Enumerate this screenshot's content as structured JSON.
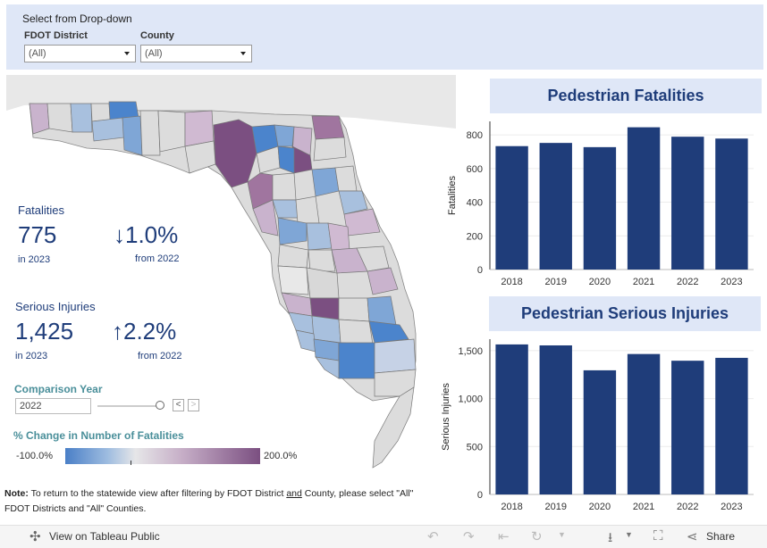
{
  "filters": {
    "title": "Select from Drop-down",
    "district_label": "FDOT District",
    "district_value": "(All)",
    "county_label": "County",
    "county_value": "(All)"
  },
  "kpis": {
    "fatalities": {
      "label": "Fatalities",
      "value": "775",
      "year_text": "in 2023",
      "change_arrow": "↓",
      "change_value": "1.0%",
      "change_text": "from 2022"
    },
    "injuries": {
      "label": "Serious Injuries",
      "value": "1,425",
      "year_text": "in 2023",
      "change_arrow": "↑",
      "change_value": "2.2%",
      "change_text": "from 2022"
    }
  },
  "comparison": {
    "label": "Comparison Year",
    "value": "2022",
    "prev_symbol": "<",
    "next_symbol": ">"
  },
  "legend": {
    "title": "% Change in Number of Fatalities",
    "min_label": "-100.0%",
    "max_label": "200.0%",
    "colors": [
      "#4a7fc7",
      "#e6e6e8",
      "#7b4f81"
    ]
  },
  "note": {
    "bold": "Note:",
    "text1": " To return to the statewide view after filtering by FDOT District ",
    "underlined": "and",
    "text2": " County, please select \"All\" FDOT Districts  and \"All\" Counties."
  },
  "chart_data": [
    {
      "type": "bar",
      "title": "Pedestrian Fatalities",
      "ylabel": "Fatalities",
      "categories": [
        "2018",
        "2019",
        "2020",
        "2021",
        "2022",
        "2023"
      ],
      "values": [
        733,
        752,
        727,
        845,
        789,
        778
      ],
      "ylim": [
        0,
        880
      ],
      "yticks": [
        0,
        200,
        400,
        600,
        800
      ],
      "ytick_labels": [
        "0",
        "200",
        "400",
        "600",
        "800"
      ],
      "bar_color": "#1f3d7a",
      "grid": true
    },
    {
      "type": "bar",
      "title": "Pedestrian Serious Injuries",
      "ylabel": "Serious Injuries",
      "categories": [
        "2018",
        "2019",
        "2020",
        "2021",
        "2022",
        "2023"
      ],
      "values": [
        1565,
        1555,
        1295,
        1465,
        1395,
        1425
      ],
      "ylim": [
        0,
        1620
      ],
      "yticks": [
        0,
        500,
        1000,
        1500
      ],
      "ytick_labels": [
        "0",
        "500",
        "1,000",
        "1,500"
      ],
      "bar_color": "#1f3d7a",
      "grid": true
    }
  ],
  "toolbar": {
    "view_label": "View on Tableau Public",
    "share_label": "Share",
    "icons": [
      "tableau-logo-icon",
      "undo-icon",
      "redo-icon",
      "revert-icon",
      "refresh-icon",
      "download-icon",
      "fullscreen-icon",
      "share-icon"
    ]
  }
}
